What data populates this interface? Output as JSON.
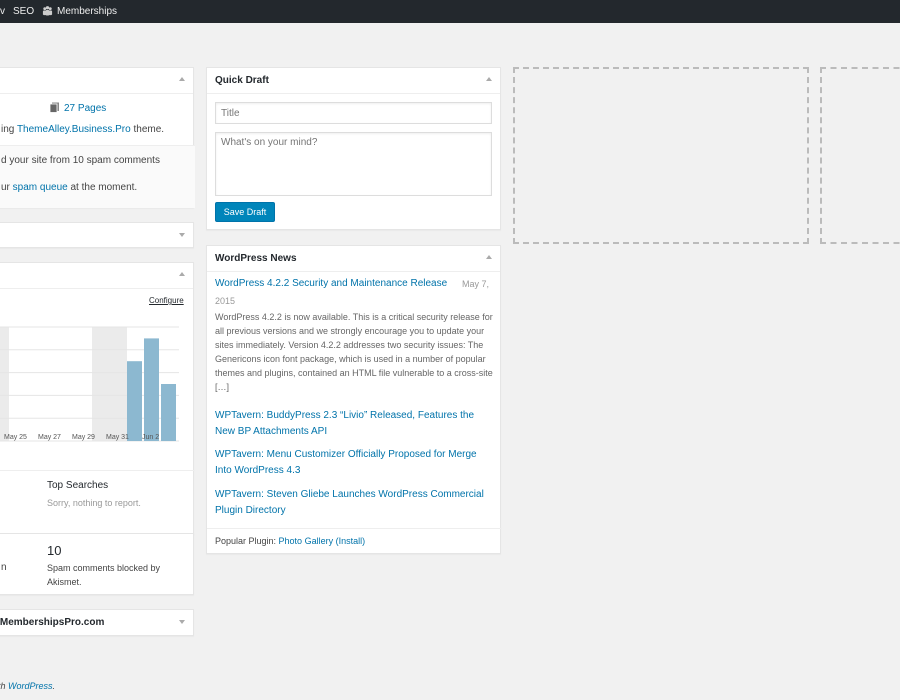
{
  "adminbar": {
    "partial_item": "v",
    "seo": "SEO",
    "memberships": "Memberships"
  },
  "at_a_glance": {
    "pages": "27 Pages",
    "theme_prefix": "ing ",
    "theme_name": "ThemeAlley.Business.Pro",
    "theme_suffix": " theme.",
    "akismet_line": "d your site from 10 spam comments",
    "spam_prefix": "ur ",
    "spam_link": "spam queue",
    "spam_suffix": " at the moment."
  },
  "stats": {
    "configure": "Configure",
    "top_searches_title": "Top Searches",
    "top_searches_empty": "Sorry, nothing to report.",
    "partial_left": "n",
    "spam_count": "10",
    "spam_label": "Spam comments blocked by Akismet."
  },
  "bottom_widget": {
    "title": "idMembershipsPro.com"
  },
  "quick_draft": {
    "title": "Quick Draft",
    "title_placeholder": "Title",
    "content_placeholder": "What's on your mind?",
    "save_label": "Save Draft"
  },
  "news": {
    "title": "WordPress News",
    "main_title": "WordPress 4.2.2 Security and Maintenance Release",
    "main_date_a": "May 7,",
    "main_date_b": "2015",
    "excerpt": "WordPress 4.2.2 is now available. This is a critical security release for all previous versions and we strongly encourage you to update your sites immediately. Version 4.2.2 addresses two security issues: The Genericons icon font package, which is used in a number of popular themes and plugins, contained an HTML file vulnerable to a cross-site […]",
    "items": [
      "WPTavern: BuddyPress 2.3 “Livio” Released, Features the New BP Attachments API",
      "WPTavern: Menu Customizer Officially Proposed for Merge Into WordPress 4.3",
      "WPTavern: Steven Gliebe Launches WordPress Commercial Plugin Directory"
    ],
    "popular_prefix": "Popular Plugin: ",
    "popular_plugin": "Photo Gallery",
    "popular_install": "(Install)"
  },
  "footer": {
    "prefix": "th ",
    "link": "WordPress",
    "suffix": "."
  },
  "chart_data": {
    "type": "bar",
    "categories": [
      "May 25",
      "May 27",
      "May 29",
      "May 31",
      "Jun 2"
    ],
    "series": [
      {
        "values": [
          0,
          0,
          0,
          0,
          0,
          0,
          0,
          0,
          0,
          0,
          0,
          0,
          0,
          3.5,
          4.5,
          2.5
        ]
      }
    ],
    "visible_bars": [
      3.5,
      4.5,
      2.5
    ],
    "ylim": [
      0,
      5
    ],
    "grid": true,
    "weekend_shading": true,
    "colors": {
      "bar": "#8cb8d0",
      "shade": "#ebebeb",
      "grid": "#e5e5e5"
    }
  }
}
